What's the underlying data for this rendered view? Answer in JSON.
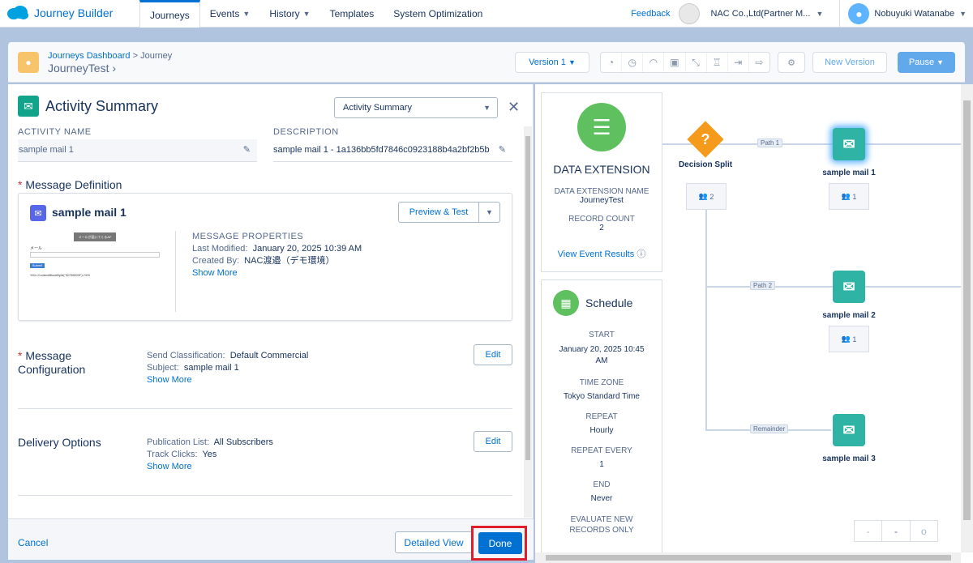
{
  "topbar": {
    "app_name": "Journey Builder",
    "nav": [
      {
        "label": "Journeys"
      },
      {
        "label": "Events"
      },
      {
        "label": "History"
      },
      {
        "label": "Templates"
      },
      {
        "label": "System Optimization"
      }
    ],
    "feedback": "Feedback",
    "org": "NAC Co.,Ltd(Partner M...",
    "user": "Nobuyuki Watanabe"
  },
  "header": {
    "breadcrumb_root": "Journeys Dashboard",
    "breadcrumb_sep": ">",
    "breadcrumb_current": "Journey",
    "journey_name": "JourneyTest",
    "version": "Version 1",
    "new_version": "New Version",
    "pause": "Pause"
  },
  "panel": {
    "title": "Activity Summary",
    "select_value": "Activity Summary",
    "activity_name_label": "ACTIVITY NAME",
    "activity_name_value": "sample mail 1",
    "description_label": "DESCRIPTION",
    "description_value": "sample mail 1 - 1a136bb5fd7846c0923188b4a2bf2b5b",
    "message_definition": "Message Definition",
    "message_name": "sample mail 1",
    "preview_test": "Preview & Test",
    "thumb_header": "メールが届いてくるAF",
    "thumb_label": "メール",
    "thumb_submit": "Submit",
    "thumb_code": "%%=ContentBlockById(\"30769099\")=%%",
    "props_title": "MESSAGE PROPERTIES",
    "last_modified_label": "Last Modified:",
    "last_modified_value": "January 20, 2025 10:39 AM",
    "created_by_label": "Created By:",
    "created_by_value": "NAC渡邉（デモ環境）",
    "show_more": "Show More",
    "msg_config_title": "Message Configuration",
    "send_class_label": "Send Classification:",
    "send_class_value": "Default Commercial",
    "subject_label": "Subject:",
    "subject_value": "sample mail 1",
    "edit": "Edit",
    "delivery_title": "Delivery Options",
    "pub_list_label": "Publication List:",
    "pub_list_value": "All Subscribers",
    "track_label": "Track Clicks:",
    "track_value": "Yes",
    "cancel": "Cancel",
    "detailed_view": "Detailed View",
    "done": "Done"
  },
  "canvas": {
    "de_title": "DATA EXTENSION",
    "de_name_label": "DATA EXTENSION NAME",
    "de_name_value": "JourneyTest",
    "record_count_label": "RECORD COUNT",
    "record_count_value": "2",
    "view_results": "View Event Results",
    "schedule_title": "Schedule",
    "start_label": "START",
    "start_value": "January 20, 2025 10:45 AM",
    "tz_label": "TIME ZONE",
    "tz_value": "Tokyo Standard Time",
    "repeat_label": "REPEAT",
    "repeat_value": "Hourly",
    "repeat_every_label": "REPEAT EVERY",
    "repeat_every_value": "1",
    "end_label": "END",
    "end_value": "Never",
    "evaluate_label": "EVALUATE NEW RECORDS ONLY",
    "decision_label": "Decision Split",
    "decision_count": "2",
    "path1": "Path 1",
    "path2": "Path 2",
    "remainder": "Remainder",
    "mail1": "sample mail 1",
    "mail1_count": "1",
    "mail2": "sample mail 2",
    "mail2_count": "1",
    "mail3": "sample mail 3",
    "zoom_out": "-",
    "zoom_mid": "-",
    "zoom_in": "o"
  }
}
